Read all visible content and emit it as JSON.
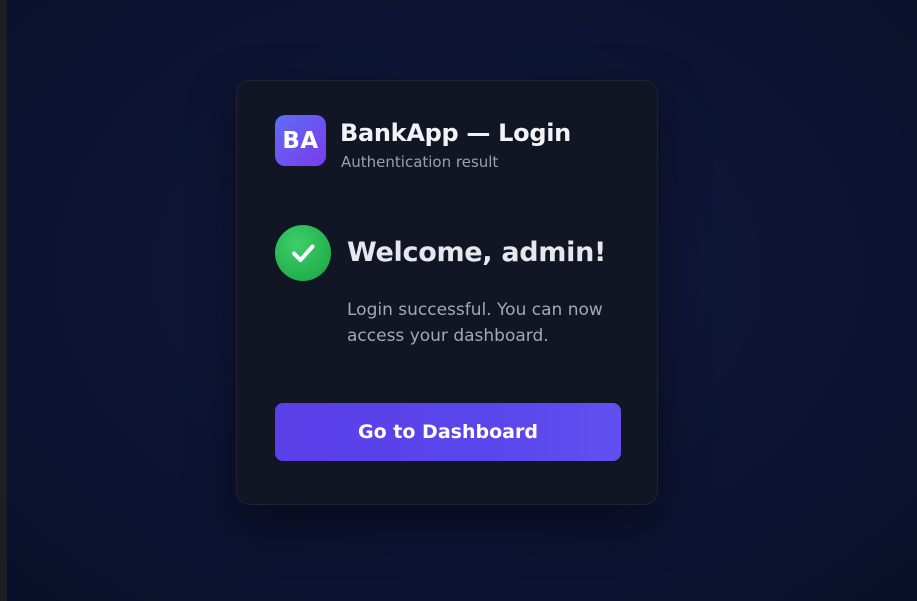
{
  "app": {
    "logo_text": "BA",
    "title": "BankApp — Login",
    "subtitle": "Authentication result"
  },
  "result": {
    "status_icon": "check-circle-icon",
    "status_color": "#22b14c",
    "heading": "Welcome, admin!",
    "message": "Login successful. You can now access your dashboard."
  },
  "actions": {
    "dashboard_label": "Go to Dashboard"
  },
  "colors": {
    "accent": "#5b3fe8",
    "logo_gradient_start": "#5c6ef5",
    "logo_gradient_end": "#7c3aed",
    "background": "#0d1433",
    "card": "#111524"
  }
}
